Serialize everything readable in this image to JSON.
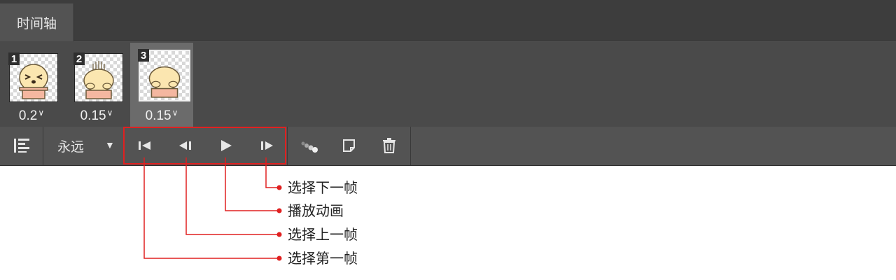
{
  "panel": {
    "tab_label": "时间轴"
  },
  "frames": [
    {
      "number": "1",
      "delay": "0.2",
      "selected": false
    },
    {
      "number": "2",
      "delay": "0.15",
      "selected": false
    },
    {
      "number": "3",
      "delay": "0.15",
      "selected": true
    }
  ],
  "toolbar": {
    "loop_value": "永远",
    "dropdown_arrow": "▼",
    "buttons": [
      "convert-timeline-icon",
      "first-frame-icon",
      "previous-frame-icon",
      "play-icon",
      "next-frame-icon",
      "tween-icon",
      "duplicate-frame-icon",
      "delete-frame-icon"
    ]
  },
  "annotations": {
    "next_frame": "选择下一帧",
    "play": "播放动画",
    "previous_frame": "选择上一帧",
    "first_frame": "选择第一帧"
  },
  "colors": {
    "highlight": "#e02020",
    "panel_bg": "#535353",
    "tabbar_bg": "#3d3d3d"
  }
}
